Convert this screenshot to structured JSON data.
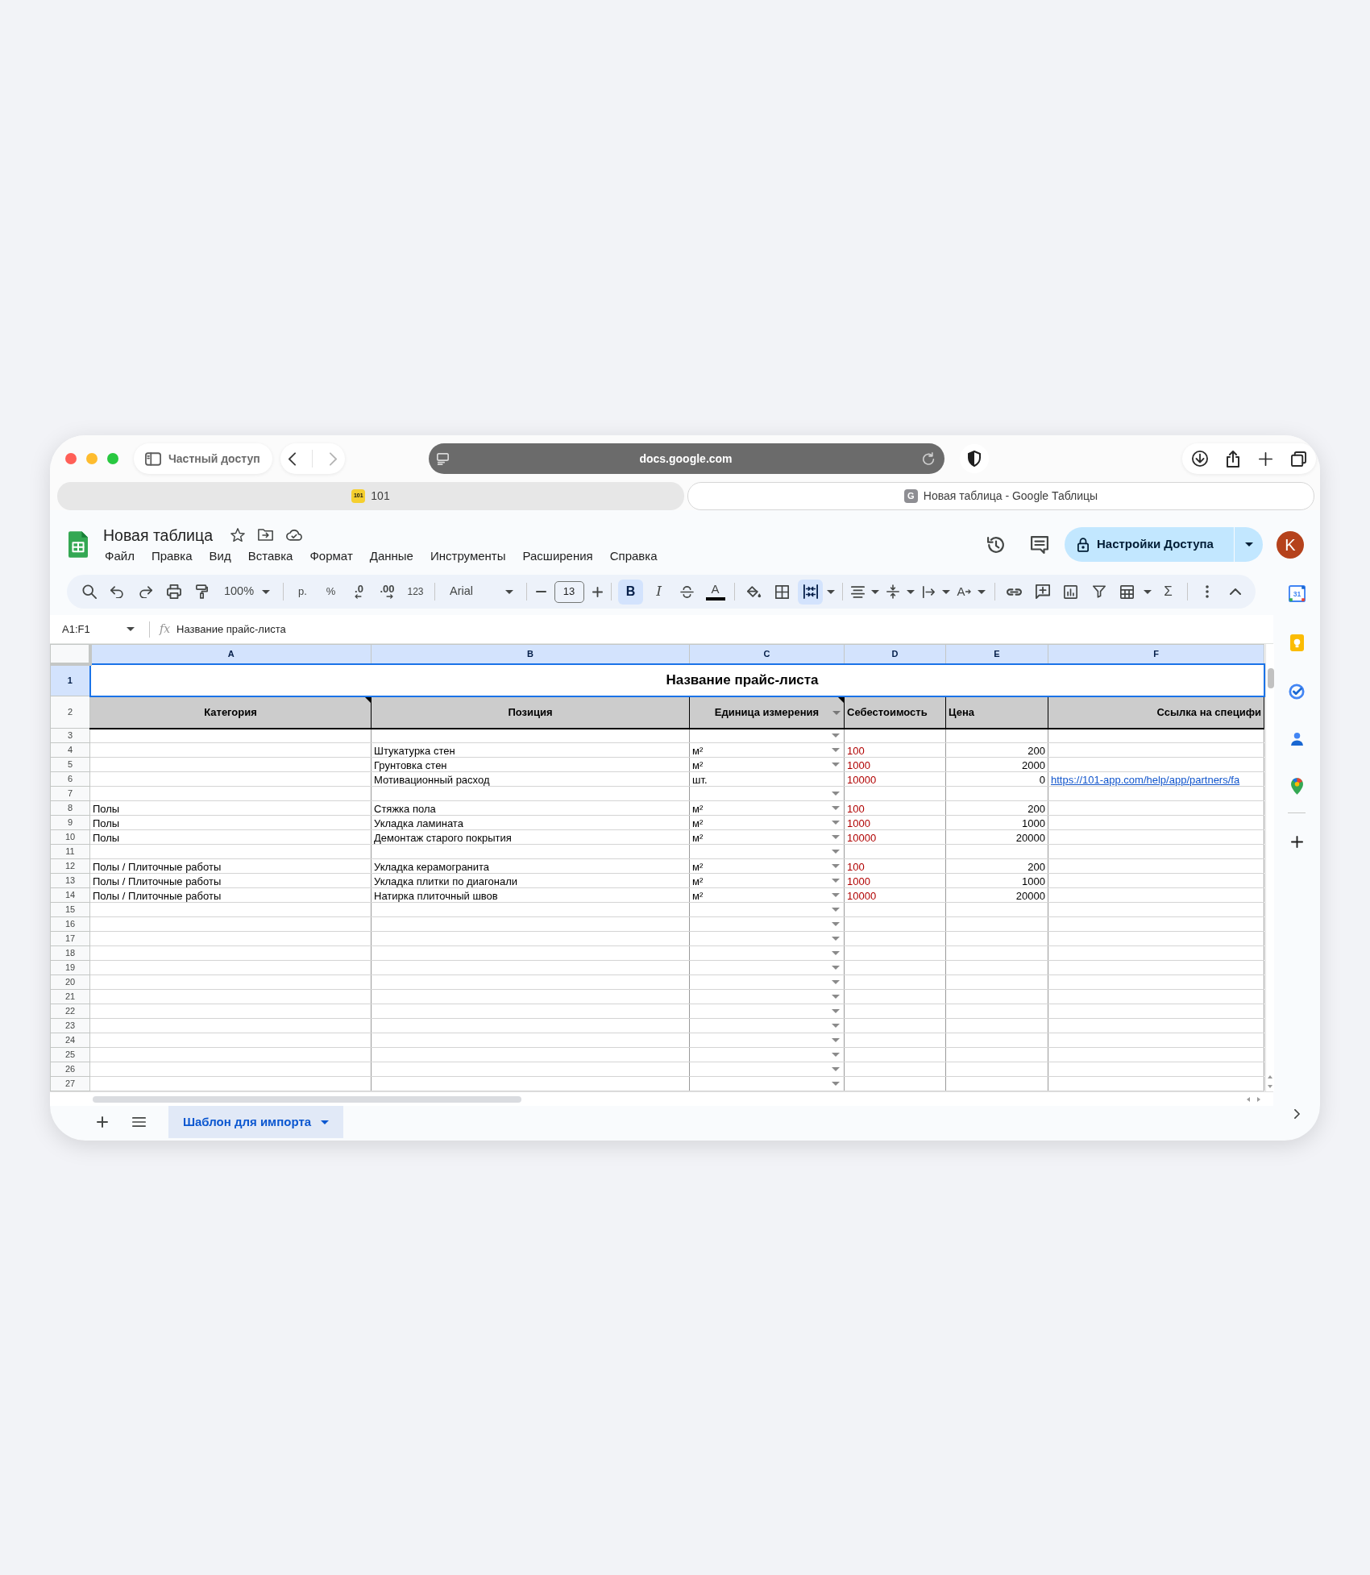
{
  "browser": {
    "private_label": "Частный доступ",
    "address": "docs.google.com",
    "tabs": [
      {
        "favicon": "101",
        "title": "101",
        "selected": false
      },
      {
        "favicon": "G",
        "title": "Новая таблица - Google Таблицы",
        "selected": true
      }
    ]
  },
  "header": {
    "title": "Новая таблица",
    "menu": [
      "Файл",
      "Правка",
      "Вид",
      "Вставка",
      "Формат",
      "Данные",
      "Инструменты",
      "Расширения",
      "Справка"
    ],
    "share_button": "Настройки Доступа",
    "avatar": "K"
  },
  "toolbar": {
    "zoom": "100%",
    "currency": "р.",
    "percent": "%",
    "decimal_decrease": ".0",
    "decimal_increase": ".00",
    "number_formats": "123",
    "font": "Arial",
    "font_size": "13",
    "styles": [
      {
        "glyph": "B",
        "selected": true
      },
      {
        "glyph": "I",
        "selected": false
      }
    ],
    "text_color_glyph": "A",
    "merge_selected": true,
    "rotation_glyph": "A",
    "functions_glyph": "Σ"
  },
  "formula_bar": {
    "range": "A1:F1",
    "fx": "fx",
    "formula": "Название прайс-листа"
  },
  "sheet": {
    "columns": [
      {
        "letter": "A",
        "selected": true
      },
      {
        "letter": "B",
        "selected": true
      },
      {
        "letter": "C",
        "selected": true
      },
      {
        "letter": "D",
        "selected": true
      },
      {
        "letter": "E",
        "selected": true
      },
      {
        "letter": "F",
        "selected": true
      }
    ],
    "title_row": {
      "number": "1",
      "selected": true,
      "text": "Название прайс-листа"
    },
    "header_row": {
      "number": "2",
      "selected": false,
      "cells": [
        {
          "text": "Категория",
          "note": true,
          "dropdown": false
        },
        {
          "text": "Позиция",
          "note": false,
          "dropdown": false
        },
        {
          "text": "Единица измерения",
          "note": true,
          "dropdown": true
        },
        {
          "text": "Себестоимость",
          "note": false,
          "dropdown": false
        },
        {
          "text": "Цена",
          "note": false,
          "dropdown": false
        },
        {
          "text": "Ссылка на специфи",
          "note": false,
          "dropdown": false
        }
      ]
    },
    "rows": [
      {
        "number": "3",
        "selected": false,
        "dropdown": true
      },
      {
        "number": "4",
        "selected": false,
        "dropdown": true,
        "position": "Штукатурка стен",
        "unit": "м²",
        "cost": "100",
        "price": "200"
      },
      {
        "number": "5",
        "selected": false,
        "dropdown": true,
        "position": "Грунтовка стен",
        "unit": "м²",
        "cost": "1000",
        "price": "2000"
      },
      {
        "number": "6",
        "selected": false,
        "dropdown": false,
        "position": "Мотивационный расход",
        "unit": "шт.",
        "cost": "10000",
        "price": "0",
        "link": "https://101-app.com/help/app/partners/fa"
      },
      {
        "number": "7",
        "selected": false,
        "dropdown": true
      },
      {
        "number": "8",
        "selected": false,
        "dropdown": true,
        "category": "Полы",
        "position": "Стяжка пола",
        "unit": "м²",
        "cost": "100",
        "price": "200"
      },
      {
        "number": "9",
        "selected": false,
        "dropdown": true,
        "category": "Полы",
        "position": "Укладка ламината",
        "unit": "м²",
        "cost": "1000",
        "price": "1000"
      },
      {
        "number": "10",
        "selected": false,
        "dropdown": true,
        "category": "Полы",
        "position": "Демонтаж старого покрытия",
        "unit": "м²",
        "cost": "10000",
        "price": "20000"
      },
      {
        "number": "11",
        "selected": false,
        "dropdown": true
      },
      {
        "number": "12",
        "selected": false,
        "dropdown": true,
        "category": "Полы / Плиточные работы",
        "position": "Укладка керамогранита",
        "unit": "м²",
        "cost": "100",
        "price": "200"
      },
      {
        "number": "13",
        "selected": false,
        "dropdown": true,
        "category": "Полы / Плиточные работы",
        "position": "Укладка плитки по диагонали",
        "unit": "м²",
        "cost": "1000",
        "price": "1000"
      },
      {
        "number": "14",
        "selected": false,
        "dropdown": true,
        "category": "Полы / Плиточные работы",
        "position": "Натирка плиточный швов",
        "unit": "м²",
        "cost": "10000",
        "price": "20000"
      },
      {
        "number": "15",
        "selected": false,
        "dropdown": true
      },
      {
        "number": "16",
        "selected": false,
        "dropdown": true
      },
      {
        "number": "17",
        "selected": false,
        "dropdown": true
      },
      {
        "number": "18",
        "selected": false,
        "dropdown": true
      },
      {
        "number": "19",
        "selected": false,
        "dropdown": true
      },
      {
        "number": "20",
        "selected": false,
        "dropdown": true
      },
      {
        "number": "21",
        "selected": false,
        "dropdown": true
      },
      {
        "number": "22",
        "selected": false,
        "dropdown": true
      },
      {
        "number": "23",
        "selected": false,
        "dropdown": true
      },
      {
        "number": "24",
        "selected": false,
        "dropdown": true
      },
      {
        "number": "25",
        "selected": false,
        "dropdown": true
      },
      {
        "number": "26",
        "selected": false,
        "dropdown": true
      },
      {
        "number": "27",
        "selected": false,
        "dropdown": true
      }
    ]
  },
  "sheet_tabs": [
    {
      "name": "Шаблон для импорта",
      "selected": true
    }
  ],
  "side_panel": {
    "calendar_day": "31"
  }
}
